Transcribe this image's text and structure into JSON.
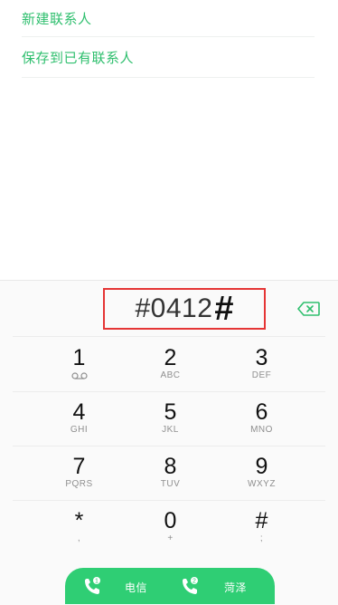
{
  "options": [
    {
      "label": "新建联系人"
    },
    {
      "label": "保存到已有联系人"
    }
  ],
  "dialer": {
    "number": "#0412",
    "cursor_char": "#"
  },
  "keys": [
    {
      "digit": "1",
      "sub": ""
    },
    {
      "digit": "2",
      "sub": "ABC"
    },
    {
      "digit": "3",
      "sub": "DEF"
    },
    {
      "digit": "4",
      "sub": "GHI"
    },
    {
      "digit": "5",
      "sub": "JKL"
    },
    {
      "digit": "6",
      "sub": "MNO"
    },
    {
      "digit": "7",
      "sub": "PQRS"
    },
    {
      "digit": "8",
      "sub": "TUV"
    },
    {
      "digit": "9",
      "sub": "WXYZ"
    },
    {
      "digit": "*",
      "sub": ","
    },
    {
      "digit": "0",
      "sub": "+"
    },
    {
      "digit": "#",
      "sub": ";"
    }
  ],
  "call_buttons": [
    {
      "label": "电信",
      "sim": "1",
      "icon": "phone-sim1-icon"
    },
    {
      "label": "菏泽",
      "sim": "2",
      "icon": "phone-sim2-icon"
    }
  ],
  "colors": {
    "accent": "#2fbf6e",
    "call_bar": "#2fce74",
    "highlight_box": "#e53535"
  }
}
